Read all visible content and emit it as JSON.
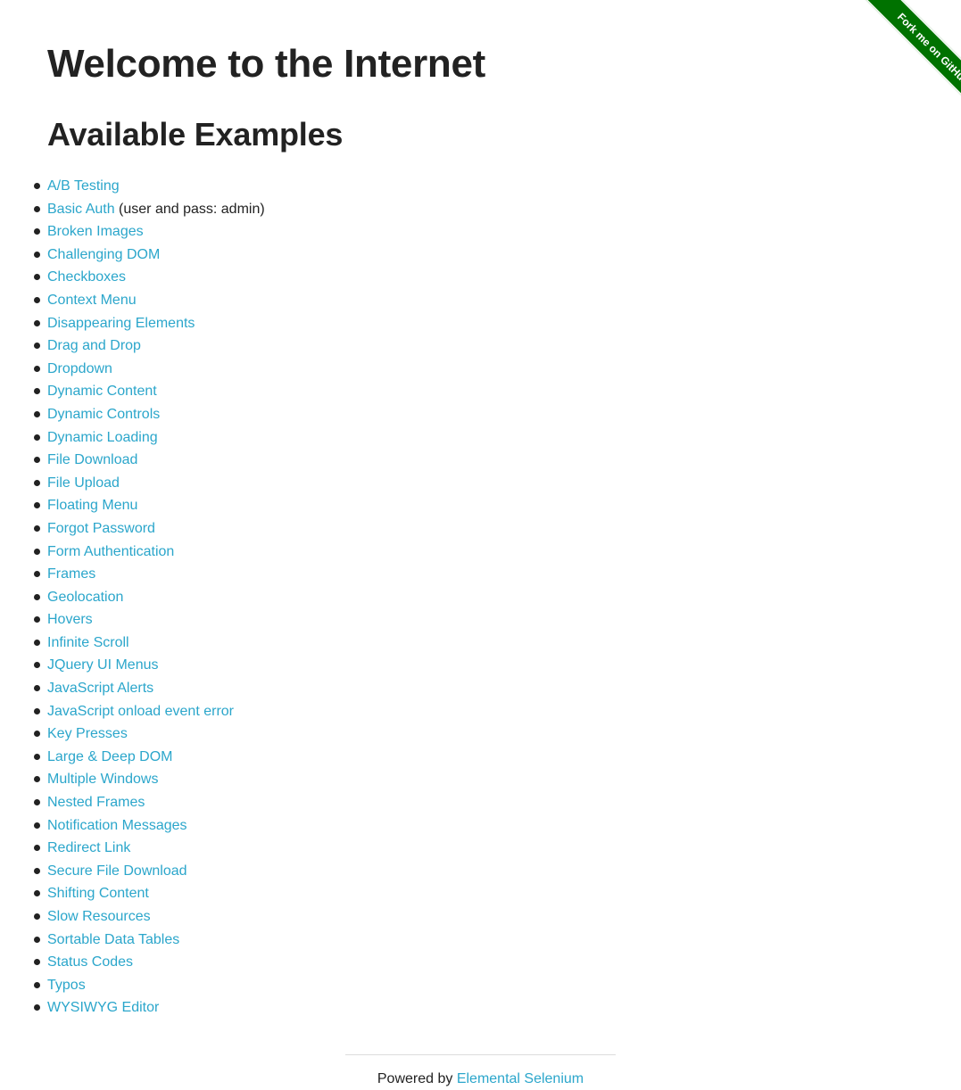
{
  "header": {
    "title": "Welcome to the Internet",
    "subtitle": "Available Examples"
  },
  "ribbon": {
    "label": "Fork me on GitHub",
    "color": "#007200"
  },
  "colors": {
    "link": "#2ba6cb",
    "text": "#222222"
  },
  "examples": [
    {
      "label": "A/B Testing",
      "note": ""
    },
    {
      "label": "Basic Auth",
      "note": " (user and pass: admin)"
    },
    {
      "label": "Broken Images",
      "note": ""
    },
    {
      "label": "Challenging DOM",
      "note": ""
    },
    {
      "label": "Checkboxes",
      "note": ""
    },
    {
      "label": "Context Menu",
      "note": ""
    },
    {
      "label": "Disappearing Elements",
      "note": ""
    },
    {
      "label": "Drag and Drop",
      "note": ""
    },
    {
      "label": "Dropdown",
      "note": ""
    },
    {
      "label": "Dynamic Content",
      "note": ""
    },
    {
      "label": "Dynamic Controls",
      "note": ""
    },
    {
      "label": "Dynamic Loading",
      "note": ""
    },
    {
      "label": "File Download",
      "note": ""
    },
    {
      "label": "File Upload",
      "note": ""
    },
    {
      "label": "Floating Menu",
      "note": ""
    },
    {
      "label": "Forgot Password",
      "note": ""
    },
    {
      "label": "Form Authentication",
      "note": ""
    },
    {
      "label": "Frames",
      "note": ""
    },
    {
      "label": "Geolocation",
      "note": ""
    },
    {
      "label": "Hovers",
      "note": ""
    },
    {
      "label": "Infinite Scroll",
      "note": ""
    },
    {
      "label": "JQuery UI Menus",
      "note": ""
    },
    {
      "label": "JavaScript Alerts",
      "note": ""
    },
    {
      "label": "JavaScript onload event error",
      "note": ""
    },
    {
      "label": "Key Presses",
      "note": ""
    },
    {
      "label": "Large & Deep DOM",
      "note": ""
    },
    {
      "label": "Multiple Windows",
      "note": ""
    },
    {
      "label": "Nested Frames",
      "note": ""
    },
    {
      "label": "Notification Messages",
      "note": ""
    },
    {
      "label": "Redirect Link",
      "note": ""
    },
    {
      "label": "Secure File Download",
      "note": ""
    },
    {
      "label": "Shifting Content",
      "note": ""
    },
    {
      "label": "Slow Resources",
      "note": ""
    },
    {
      "label": "Sortable Data Tables",
      "note": ""
    },
    {
      "label": "Status Codes",
      "note": ""
    },
    {
      "label": "Typos",
      "note": ""
    },
    {
      "label": "WYSIWYG Editor",
      "note": ""
    }
  ],
  "footer": {
    "prefix": "Powered by ",
    "link_label": "Elemental Selenium"
  }
}
